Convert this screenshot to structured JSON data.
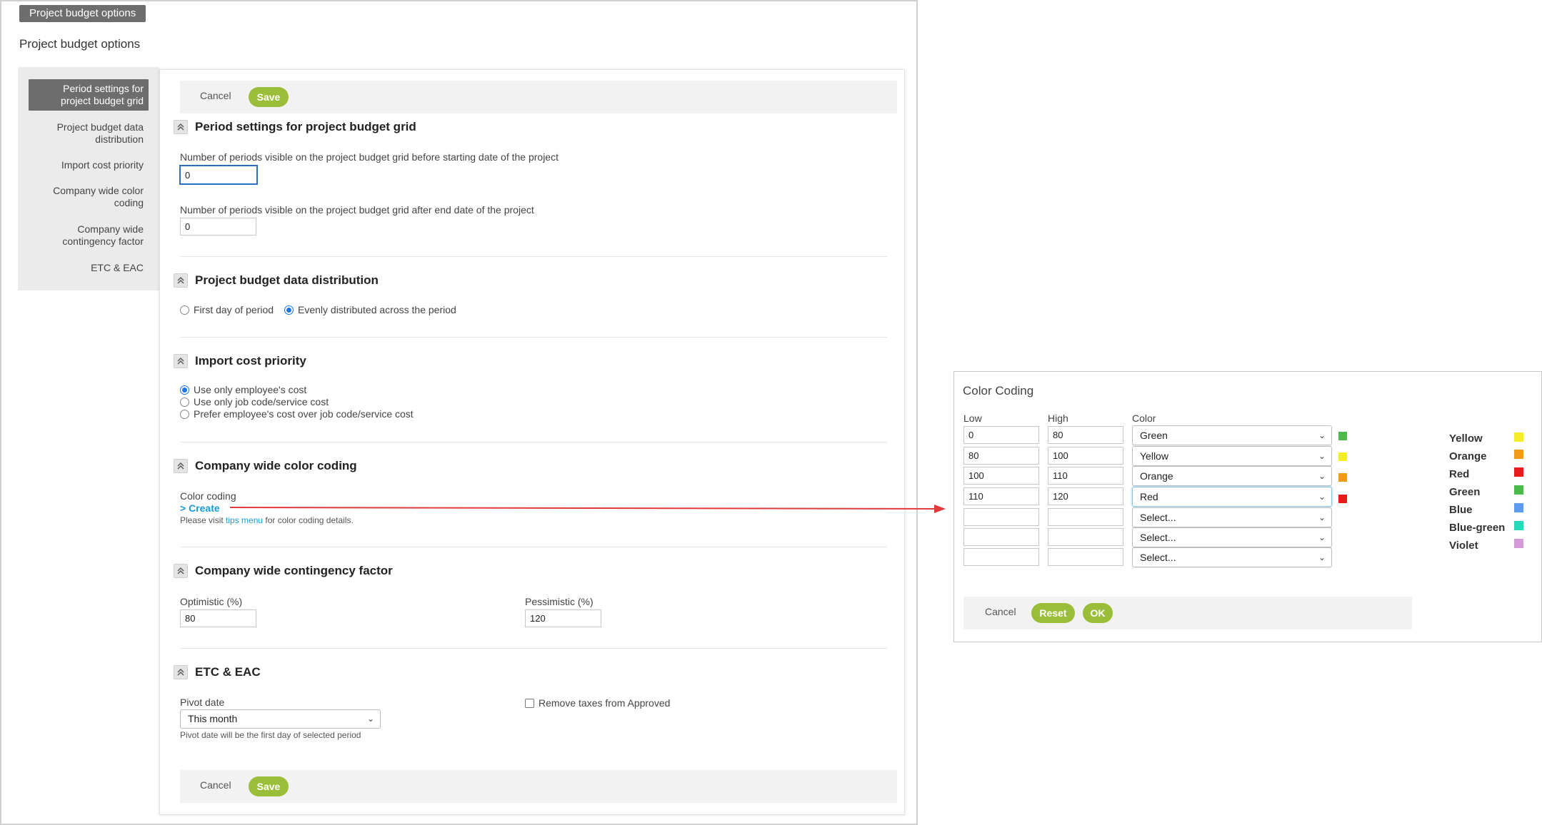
{
  "window": {
    "title_tab": "Project budget options",
    "page_title": "Project budget options"
  },
  "sidebar": {
    "items": [
      {
        "label": "Period settings for project budget grid",
        "active": true
      },
      {
        "label": "Project budget data distribution"
      },
      {
        "label": "Import cost priority"
      },
      {
        "label": "Company wide color coding"
      },
      {
        "label": "Company wide contingency factor"
      },
      {
        "label": "ETC & EAC"
      }
    ]
  },
  "toolbar": {
    "cancel_label": "Cancel",
    "save_label": "Save"
  },
  "period_settings": {
    "title": "Period settings for project budget grid",
    "before_label": "Number of periods visible on the project budget grid before starting date of the project",
    "before_value": "0",
    "after_label": "Number of periods visible on the project budget grid after end date of the project",
    "after_value": "0"
  },
  "distribution": {
    "title": "Project budget data distribution",
    "options": [
      "First day of period",
      "Evenly distributed across the period"
    ],
    "selected": "Evenly distributed across the period"
  },
  "import_cost": {
    "title": "Import cost priority",
    "options": [
      "Use only employee's cost",
      "Use only job code/service cost",
      "Prefer employee's cost over job code/service cost"
    ],
    "selected": "Use only employee's cost"
  },
  "color_coding_section": {
    "title": "Company wide color coding",
    "label": "Color coding",
    "create_link": "> Create",
    "note_prefix": "Please visit",
    "note_link": "tips menu",
    "note_suffix": "for color coding details."
  },
  "contingency": {
    "title": "Company wide contingency factor",
    "optimistic_label": "Optimistic (%)",
    "optimistic_value": "80",
    "pessimistic_label": "Pessimistic (%)",
    "pessimistic_value": "120"
  },
  "etc_eac": {
    "title": "ETC & EAC",
    "pivot_label": "Pivot date",
    "pivot_value": "This month",
    "pivot_note": "Pivot date will be the first day of selected period",
    "remove_taxes_label": "Remove taxes from Approved",
    "remove_taxes_checked": false
  },
  "color_dialog": {
    "title": "Color Coding",
    "headers": {
      "low": "Low",
      "high": "High",
      "color": "Color"
    },
    "rows": [
      {
        "low": "0",
        "high": "80",
        "color": "Green",
        "swatch": "#4cbb4c"
      },
      {
        "low": "80",
        "high": "100",
        "color": "Yellow",
        "swatch": "#f5ec2a"
      },
      {
        "low": "100",
        "high": "110",
        "color": "Orange",
        "swatch": "#f39a1a"
      },
      {
        "low": "110",
        "high": "120",
        "color": "Red",
        "swatch": "#e81c1c"
      },
      {
        "low": "",
        "high": "",
        "color": "Select...",
        "swatch": ""
      },
      {
        "low": "",
        "high": "",
        "color": "Select...",
        "swatch": ""
      },
      {
        "low": "",
        "high": "",
        "color": "Select...",
        "swatch": ""
      }
    ],
    "buttons": {
      "cancel": "Cancel",
      "reset": "Reset",
      "ok": "OK"
    },
    "legend": [
      {
        "name": "Yellow",
        "color": "#f5ec2a"
      },
      {
        "name": "Orange",
        "color": "#f39a1a"
      },
      {
        "name": "Red",
        "color": "#e81c1c"
      },
      {
        "name": "Green",
        "color": "#4cbb4c"
      },
      {
        "name": "Blue",
        "color": "#5d9cf0"
      },
      {
        "name": "Blue-green",
        "color": "#27d9b8"
      },
      {
        "name": "Violet",
        "color": "#d59ad8"
      }
    ]
  },
  "colors": {
    "accent_green": "#9bbe3a",
    "focus_blue": "#2b6fbf",
    "link_blue": "#1a9bd7",
    "arrow_red": "#e23a3a"
  }
}
